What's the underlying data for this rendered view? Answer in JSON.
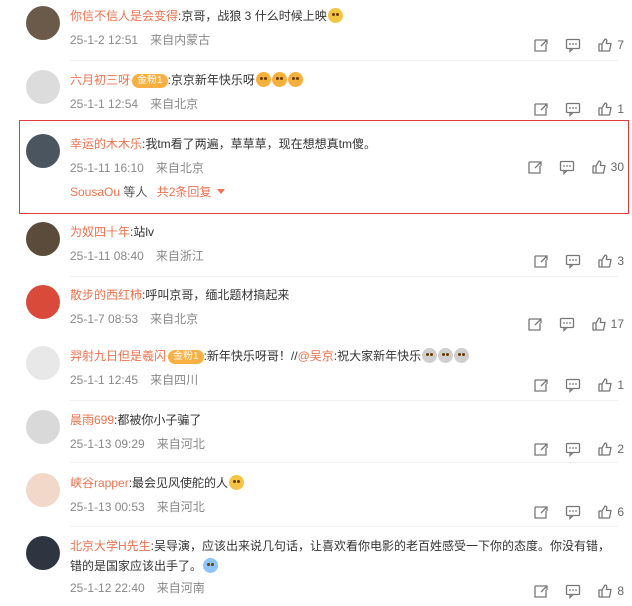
{
  "comments": [
    {
      "user": "你信不信人是会变得",
      "text": ":京哥，战狼 3 什么时候上映",
      "time": "25-1-2 12:51",
      "location": "来自内蒙古",
      "likes": "7"
    },
    {
      "user": "六月初三呀",
      "badge": "金粉1",
      "text": ":京京新年快乐呀",
      "time": "25-1-1 12:54",
      "location": "来自北京",
      "likes": "1"
    },
    {
      "user": "幸运的木木乐",
      "text": ":我tm看了两遍，草草草，现在想想真tm傻。",
      "time": "25-1-11 16:10",
      "location": "来自北京",
      "likes": "30",
      "reply_user": "SousaOu",
      "reply_mid": "等人",
      "reply_count": "共2条回复"
    },
    {
      "user": "为奴四十年",
      "text": ":站lv",
      "time": "25-1-11 08:40",
      "location": "来自浙江",
      "likes": "3"
    },
    {
      "user": "散步的西红柿",
      "text": ":呼叫京哥，缅北题材搞起来",
      "time": "25-1-7 08:53",
      "location": "来自北京",
      "likes": "17"
    },
    {
      "user": "羿射九日但是羲闪",
      "badge": "金粉1",
      "text": ":新年快乐呀哥！//",
      "mention": "@吴京",
      "mention_text": ":祝大家新年快乐",
      "time": "25-1-1 12:45",
      "location": "来自四川",
      "likes": "1"
    },
    {
      "user": "晨雨699",
      "text": ":都被你小子骗了",
      "time": "25-1-13 09:29",
      "location": "来自河北",
      "likes": "2"
    },
    {
      "user": "峡谷rapper",
      "text": ":最会见风使舵的人",
      "time": "25-1-13 00:53",
      "location": "来自河北",
      "likes": "6"
    },
    {
      "user": "北京大学H先生",
      "text": ":吴导演，应该出来说几句话，让喜欢看你电影的老百姓感受一下你的态度。你没有错，错的是国家应该出手了。",
      "time": "25-1-12 22:40",
      "location": "来自河南",
      "likes": "8"
    }
  ]
}
